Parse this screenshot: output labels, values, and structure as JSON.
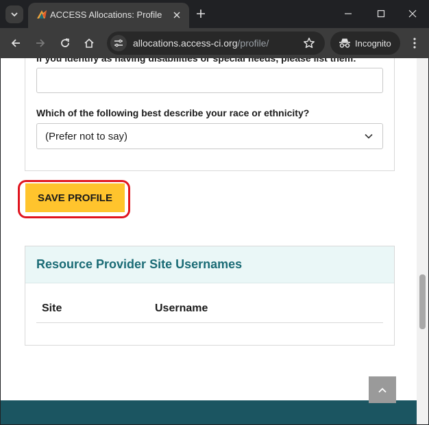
{
  "browser": {
    "tab_title": "ACCESS Allocations: Profile",
    "url_host": "allocations.access-ci.org",
    "url_path": "/profile/",
    "profile_label": "Incognito"
  },
  "form": {
    "disabilities_label": "If you identify as having disabilities or special needs, please list them:",
    "disabilities_value": "",
    "race_label": "Which of the following best describe your race or ethnicity?",
    "race_value": "(Prefer not to say)"
  },
  "save_button_label": "SAVE PROFILE",
  "resource_provider": {
    "title": "Resource Provider Site Usernames",
    "columns": [
      "Site",
      "Username"
    ]
  },
  "colors": {
    "accent_button": "#ffc42d",
    "highlight": "#e0141e",
    "heading_teal": "#1a6b75",
    "footer": "#1b5561"
  }
}
